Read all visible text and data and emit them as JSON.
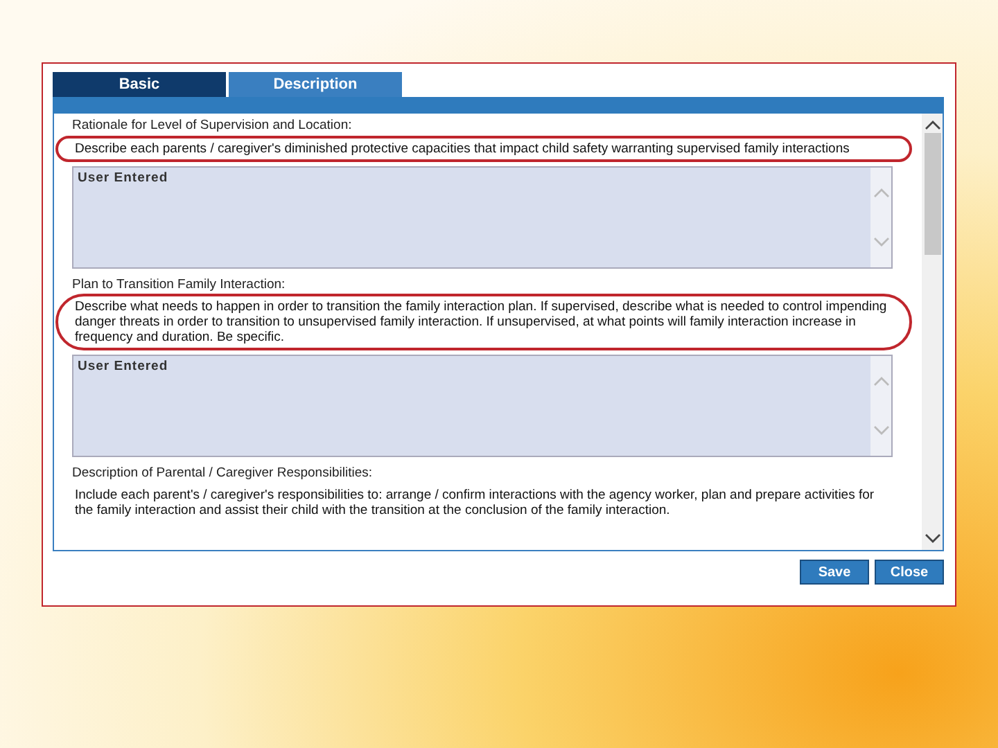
{
  "tabs": [
    {
      "label": "Basic",
      "selected": false
    },
    {
      "label": "Description",
      "selected": true
    }
  ],
  "sections": [
    {
      "heading": "Rationale for Level of Supervision and Location:",
      "prompt": "Describe each parents / caregiver's diminished protective capacities that impact child safety warranting supervised family interactions",
      "circled": true,
      "value": "User Entered"
    },
    {
      "heading": "Plan to Transition Family Interaction:",
      "prompt": "Describe what needs to happen in order to transition the family interaction plan. If supervised, describe what is needed to control impending danger threats in order to transition to unsupervised family interaction. If unsupervised, at what points will family interaction increase in frequency and duration. Be specific.",
      "circled": true,
      "value": "User Entered"
    },
    {
      "heading": "Description of Parental / Caregiver Responsibilities:",
      "prompt": "Include each parent's / caregiver's responsibilities to: arrange / confirm interactions with the agency worker, plan and prepare activities for the family interaction and assist their child with the transition at the conclusion of the family interaction."
    }
  ],
  "buttons": [
    "Save",
    "Close"
  ]
}
